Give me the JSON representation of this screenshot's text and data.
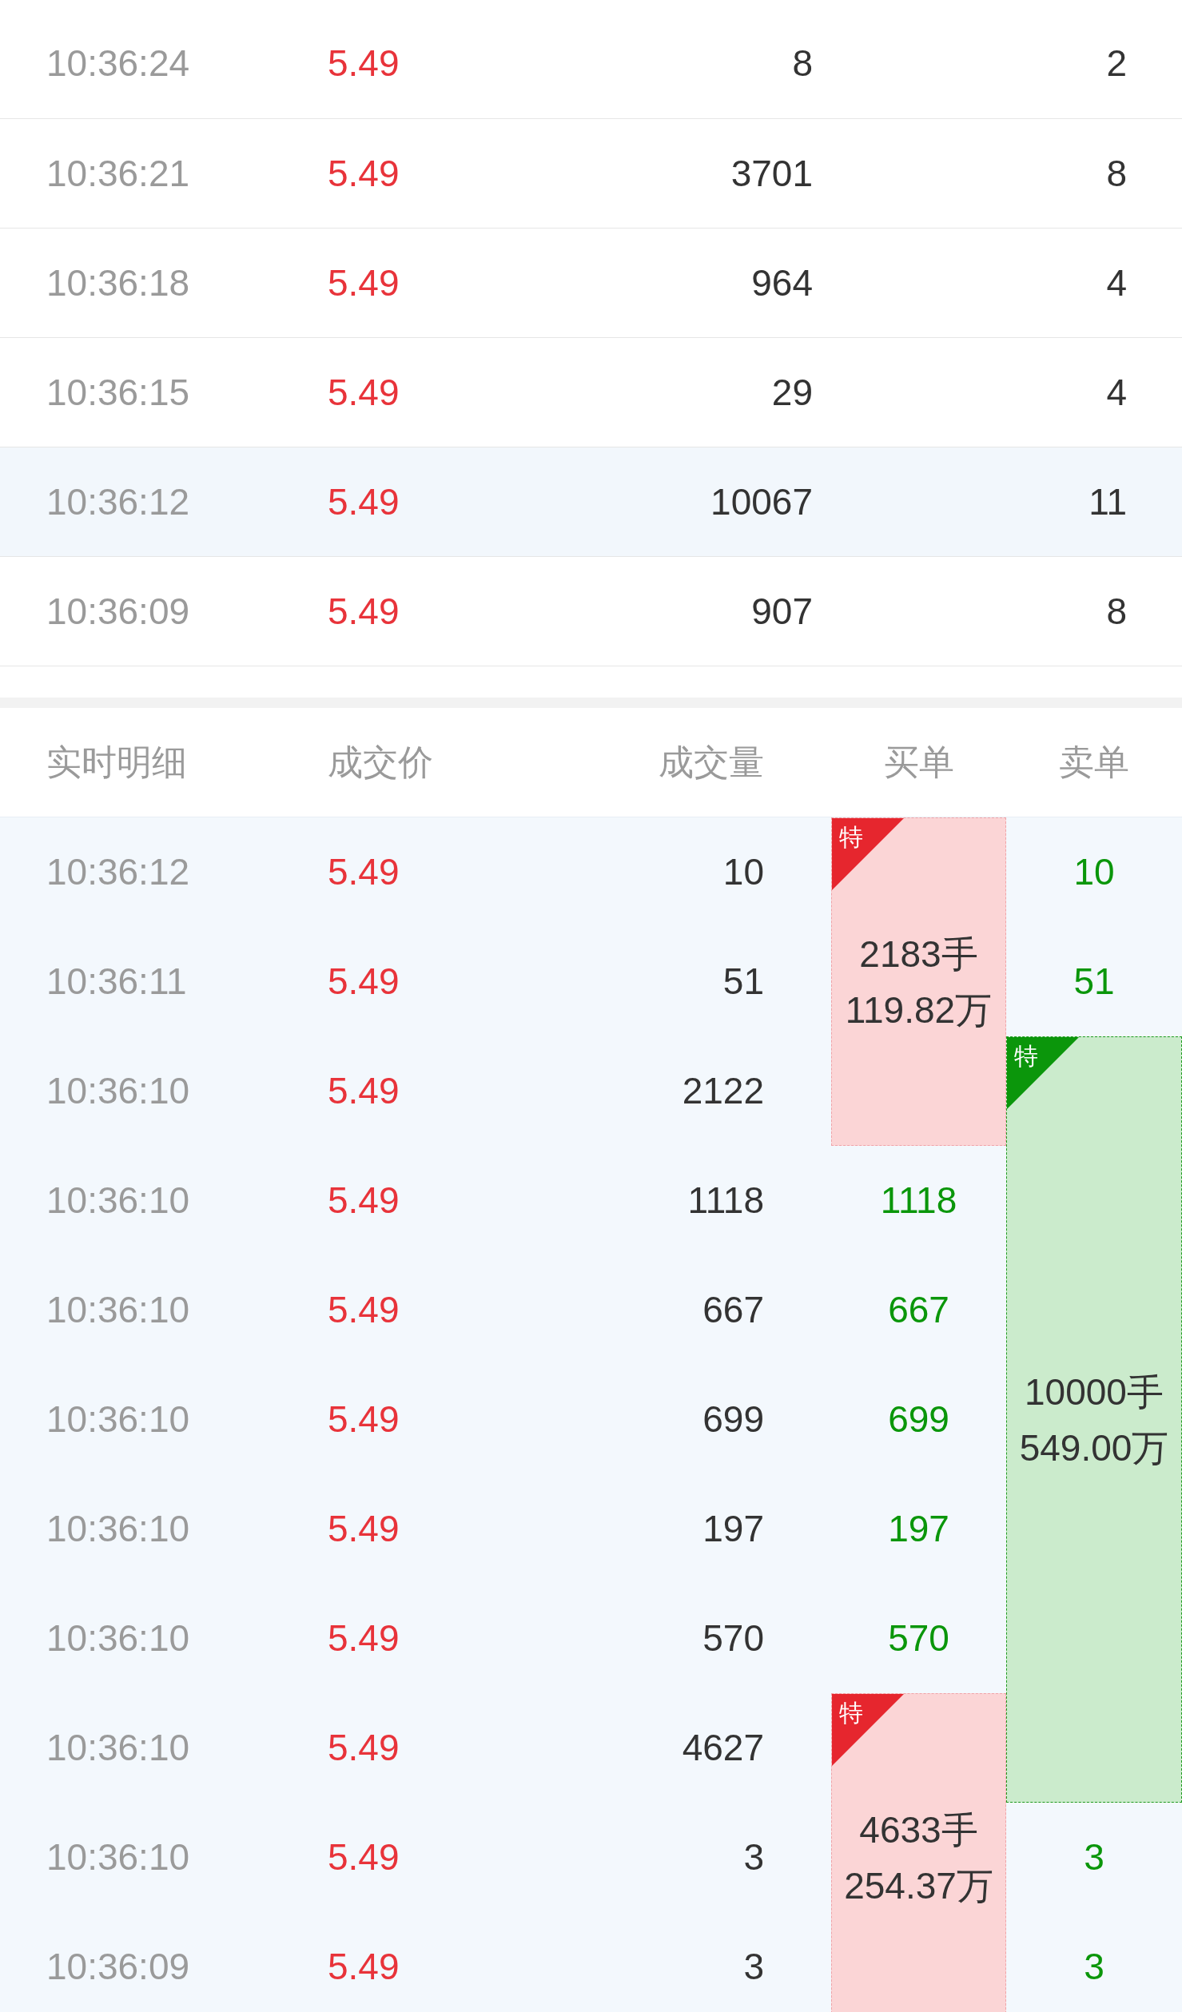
{
  "trades": {
    "rows": [
      {
        "time": "10:36:24",
        "price": "5.49",
        "volume": "8",
        "count": "2",
        "selected": false
      },
      {
        "time": "10:36:21",
        "price": "5.49",
        "volume": "3701",
        "count": "8",
        "selected": false
      },
      {
        "time": "10:36:18",
        "price": "5.49",
        "volume": "964",
        "count": "4",
        "selected": false
      },
      {
        "time": "10:36:15",
        "price": "5.49",
        "volume": "29",
        "count": "4",
        "selected": false
      },
      {
        "time": "10:36:12",
        "price": "5.49",
        "volume": "10067",
        "count": "11",
        "selected": true
      },
      {
        "time": "10:36:09",
        "price": "5.49",
        "volume": "907",
        "count": "8",
        "selected": false
      }
    ]
  },
  "detail": {
    "columns": [
      "实时明细",
      "成交价",
      "成交量",
      "买单",
      "卖单"
    ],
    "rows": [
      {
        "time": "10:36:12",
        "price": "5.49",
        "volume": "10",
        "buy": {
          "kind": "block_start",
          "tag": "特",
          "lots": "2183手",
          "amount": "119.82万"
        },
        "sell": {
          "kind": "trade",
          "text": "10"
        }
      },
      {
        "time": "10:36:11",
        "price": "5.49",
        "volume": "51",
        "buy": {
          "kind": "block"
        },
        "sell": {
          "kind": "trade",
          "text": "51"
        }
      },
      {
        "time": "10:36:10",
        "price": "5.49",
        "volume": "2122",
        "buy": {
          "kind": "block"
        },
        "sell": {
          "kind": "block_start",
          "tag": "特",
          "lots": "10000手",
          "amount": "549.00万"
        }
      },
      {
        "time": "10:36:10",
        "price": "5.49",
        "volume": "1118",
        "buy": {
          "kind": "trade",
          "text": "1118"
        },
        "sell": {
          "kind": "block"
        }
      },
      {
        "time": "10:36:10",
        "price": "5.49",
        "volume": "667",
        "buy": {
          "kind": "trade",
          "text": "667"
        },
        "sell": {
          "kind": "block"
        }
      },
      {
        "time": "10:36:10",
        "price": "5.49",
        "volume": "699",
        "buy": {
          "kind": "trade",
          "text": "699"
        },
        "sell": {
          "kind": "block"
        }
      },
      {
        "time": "10:36:10",
        "price": "5.49",
        "volume": "197",
        "buy": {
          "kind": "trade",
          "text": "197"
        },
        "sell": {
          "kind": "block"
        }
      },
      {
        "time": "10:36:10",
        "price": "5.49",
        "volume": "570",
        "buy": {
          "kind": "trade",
          "text": "570"
        },
        "sell": {
          "kind": "block"
        }
      },
      {
        "time": "10:36:10",
        "price": "5.49",
        "volume": "4627",
        "buy": {
          "kind": "block_start",
          "tag": "特",
          "lots": "4633手",
          "amount": "254.37万"
        },
        "sell": {
          "kind": "block"
        }
      },
      {
        "time": "10:36:10",
        "price": "5.49",
        "volume": "3",
        "buy": {
          "kind": "block"
        },
        "sell": {
          "kind": "trade",
          "text": "3"
        }
      },
      {
        "time": "10:36:09",
        "price": "5.49",
        "volume": "3",
        "buy": {
          "kind": "block"
        },
        "sell": {
          "kind": "trade",
          "text": "3"
        }
      }
    ]
  }
}
